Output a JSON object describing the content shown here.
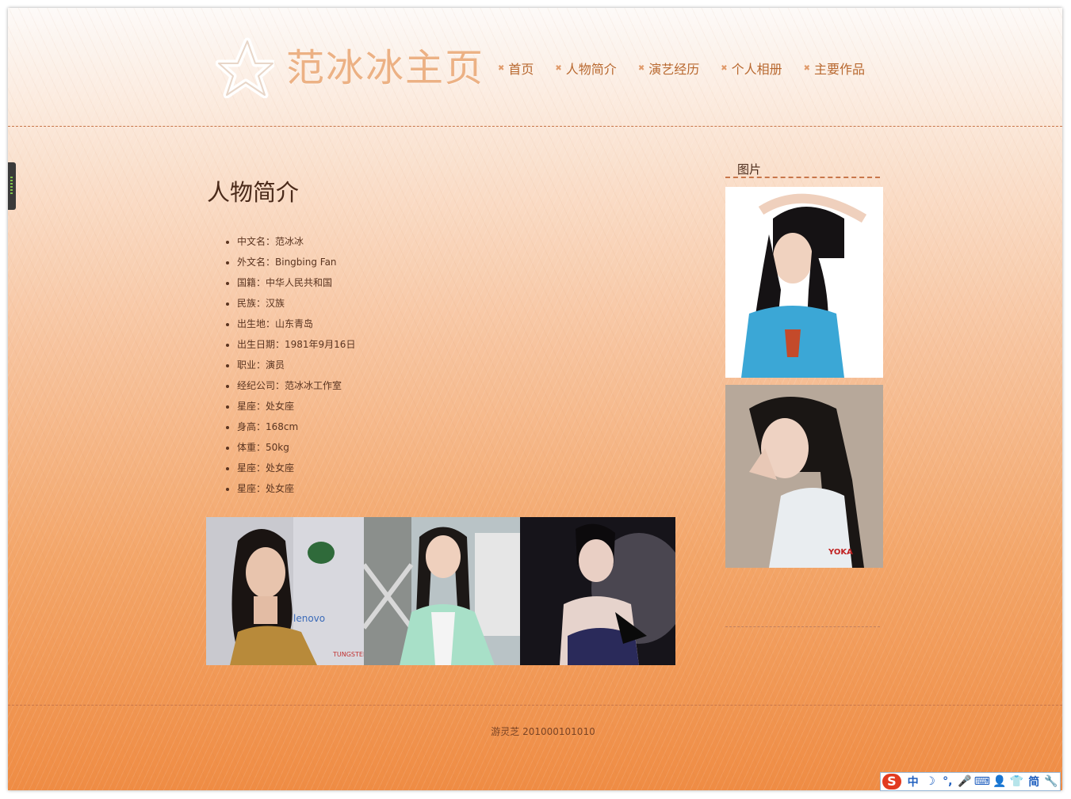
{
  "header": {
    "site_title": "范冰冰主页",
    "nav": [
      "首页",
      "人物简介",
      "演艺经历",
      "个人相册",
      "主要作品"
    ]
  },
  "main": {
    "title": "人物简介",
    "info": [
      "中文名：范冰冰",
      "外文名：Bingbing Fan",
      "国籍：中华人民共和国",
      "民族：汉族",
      "出生地：山东青岛",
      "出生日期：1981年9月16日",
      "职业：演员",
      "经纪公司：范冰冰工作室",
      "星座：处女座",
      "身高：168cm",
      "体重：50kg",
      "星座：处女座",
      "星座：处女座"
    ]
  },
  "sidebar": {
    "heading": "图片"
  },
  "footer": {
    "text": "游灵芝 201000101010"
  },
  "ime": {
    "logo": "S",
    "buttons": [
      "中",
      "☽",
      "°,",
      "🎤",
      "⌨",
      "👤",
      "👕",
      "简",
      "🔧"
    ]
  },
  "colors": {
    "nav_text": "#b8682f",
    "title_text": "#ecb184",
    "accent_border": "#c8764a"
  }
}
